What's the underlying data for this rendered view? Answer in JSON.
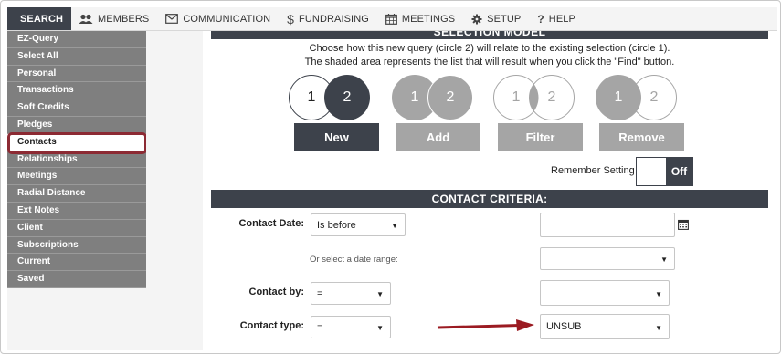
{
  "nav": {
    "items": [
      {
        "label": "SEARCH",
        "icon": "search-icon"
      },
      {
        "label": "MEMBERS",
        "icon": "members-icon"
      },
      {
        "label": "COMMUNICATION",
        "icon": "envelope-icon"
      },
      {
        "label": "FUNDRAISING",
        "icon": "dollar-icon"
      },
      {
        "label": "MEETINGS",
        "icon": "calendar-icon"
      },
      {
        "label": "SETUP",
        "icon": "gear-icon"
      },
      {
        "label": "HELP",
        "icon": "question-icon"
      }
    ]
  },
  "sidebar": {
    "items": [
      {
        "label": "EZ-Query"
      },
      {
        "label": "Select All"
      },
      {
        "label": "Personal"
      },
      {
        "label": "Transactions"
      },
      {
        "label": "Soft Credits"
      },
      {
        "label": "Pledges"
      },
      {
        "label": "Contacts"
      },
      {
        "label": "Relationships"
      },
      {
        "label": "Meetings"
      },
      {
        "label": "Radial Distance"
      },
      {
        "label": "Ext Notes"
      },
      {
        "label": "Client"
      },
      {
        "label": "Subscriptions"
      },
      {
        "label": "Current"
      },
      {
        "label": "Saved"
      }
    ],
    "selected": "Contacts"
  },
  "selection_model": {
    "title": "SELECTION MODEL",
    "line1": "Choose how this new query (circle 2) will relate to the existing selection (circle 1).",
    "line2": "The shaded area represents the list that will result when you click the \"Find\" button.",
    "modes": [
      {
        "label": "New",
        "c1": "1",
        "c2": "2"
      },
      {
        "label": "Add",
        "c1": "1",
        "c2": "2"
      },
      {
        "label": "Filter",
        "c1": "1",
        "c2": "2"
      },
      {
        "label": "Remove",
        "c1": "1",
        "c2": "2"
      }
    ],
    "remember_label": "Remember Setting",
    "toggle_state": "Off"
  },
  "criteria": {
    "title": "CONTACT CRITERIA:",
    "contact_date_label": "Contact Date:",
    "contact_date_op": "Is before",
    "contact_date_value": "",
    "date_range_hint": "Or select a date range:",
    "date_range_value": "",
    "contact_by_label": "Contact by:",
    "contact_by_op": "=",
    "contact_by_value": "",
    "contact_type_label": "Contact type:",
    "contact_type_op": "=",
    "contact_type_value": "UNSUB"
  },
  "colors": {
    "dark": "#3d424b",
    "sidebar": "#7f7f7f",
    "muted": "#a5a5a5",
    "highlight": "#8c2a33",
    "arrow": "#9b1b22"
  }
}
